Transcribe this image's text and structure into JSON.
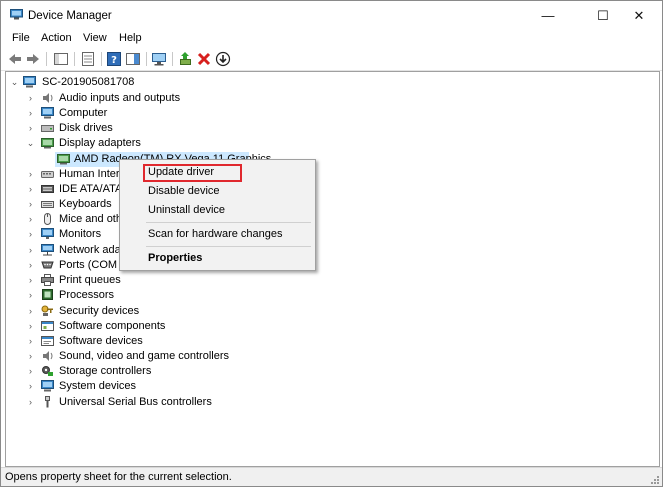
{
  "window": {
    "title": "Device Manager",
    "minimize": "—",
    "maximize": "☐",
    "close": "✕"
  },
  "menubar": [
    "File",
    "Action",
    "View",
    "Help"
  ],
  "tree": {
    "root": "SC-201905081708",
    "items": [
      {
        "label": "Audio inputs and outputs",
        "icon": "speaker-icon"
      },
      {
        "label": "Computer",
        "icon": "computer-icon"
      },
      {
        "label": "Disk drives",
        "icon": "disk-drive-icon"
      },
      {
        "label": "Display adapters",
        "icon": "display-adapter-icon",
        "expanded": true
      },
      {
        "label": "AMD Radeon(TM) RX Vega 11 Graphics",
        "icon": "display-adapter-icon",
        "child": true,
        "selected": true
      },
      {
        "label": "Human Interf",
        "icon": "hid-icon"
      },
      {
        "label": "IDE ATA/ATAP",
        "icon": "ide-controller-icon"
      },
      {
        "label": "Keyboards",
        "icon": "keyboard-icon"
      },
      {
        "label": "Mice and othe",
        "icon": "mouse-icon"
      },
      {
        "label": "Monitors",
        "icon": "monitor-icon"
      },
      {
        "label": "Network adap",
        "icon": "network-adapter-icon"
      },
      {
        "label": "Ports (COM &",
        "icon": "port-icon"
      },
      {
        "label": "Print queues",
        "icon": "printer-icon"
      },
      {
        "label": "Processors",
        "icon": "processor-icon"
      },
      {
        "label": "Security devices",
        "icon": "security-key-icon"
      },
      {
        "label": "Software components",
        "icon": "software-component-icon"
      },
      {
        "label": "Software devices",
        "icon": "software-device-icon"
      },
      {
        "label": "Sound, video and game controllers",
        "icon": "speaker-icon"
      },
      {
        "label": "Storage controllers",
        "icon": "storage-controller-icon"
      },
      {
        "label": "System devices",
        "icon": "system-device-icon"
      },
      {
        "label": "Universal Serial Bus controllers",
        "icon": "usb-icon"
      }
    ]
  },
  "context_menu": {
    "update_driver": "Update driver",
    "disable_device": "Disable device",
    "uninstall_device": "Uninstall device",
    "scan_hardware": "Scan for hardware changes",
    "properties": "Properties"
  },
  "status": {
    "text": "Opens property sheet for the current selection."
  },
  "colors": {
    "selection": "#cce8ff",
    "highlight": "#e0282e",
    "accent": "#0078d7"
  }
}
